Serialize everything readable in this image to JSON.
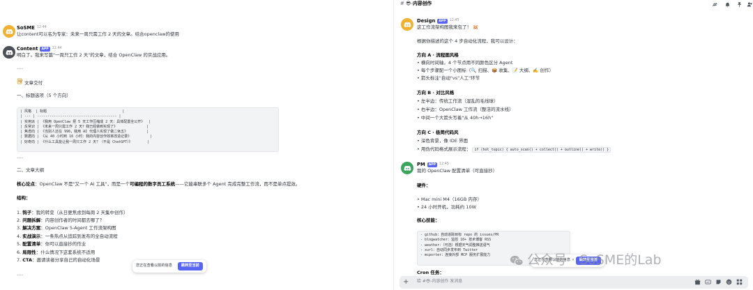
{
  "left": {
    "msg1": {
      "name": "SoSME",
      "time": "12:44",
      "text": "让content可以名为专家：未来一周只需工作 2 天的文章。结合openclaw的使用"
    },
    "msg2": {
      "name": "Content",
      "badge": "APP",
      "time": "12:44",
      "intro": "明白了。我来写篇\"一周只工作 2 天\"的文章，结合 OpenClaw 的实战应用。",
      "hr1": "----",
      "deliver": "文章交付",
      "sec1": "一、标题选项（5 个方向）",
      "table": "| 风格  | 标题                                    |\n| --- | -------------------------------------- |\n| 实用派 | 《我用 OpenClaw 把 5 天工作压缩成 2 天：具体配置全公开》  |\n| 反常识 | 《未来一周只需工作 2 天？我已经做到实现了》              |\n| 焦虑向 | 《当别人还在 996，我用 AI 代理人实现了做二休五》         |\n| 数据向 | 《从 40 小时到 16 小时：我的内容创作效率改造记录》         |\n| 好奇向 | 《什么工具能让我一周只工作 2 天？（不是 ChatGPT）》       |",
      "hr2": "----",
      "sec2": "二、文章大纲",
      "core_label": "核心论点",
      "core_text": "：OpenClaw 不是\"又一个 AI 工具\"，而是一个",
      "core_bold": "可编程的数字员工系统",
      "core_tail": "——它能串联多个 Agent 完成完整工作流，而不是单点提效。",
      "struct": "结构：",
      "items": [
        {
          "n": "1.",
          "b": "钩子",
          "t": "：我的转变（从日更焦虑到每周 2 天集中创作）"
        },
        {
          "n": "2.",
          "b": "问题拆解",
          "t": "：内容创作者的时间都去哪了？"
        },
        {
          "n": "3.",
          "b": "解决方案",
          "t": "：OpenClaw 5-Agent 工作流架构图"
        },
        {
          "n": "4.",
          "b": "实战演示",
          "t": "：一条热点从追踪到发布的全自动流程"
        },
        {
          "n": "5.",
          "b": "配置清单",
          "t": "：你可以直接抄的作业"
        },
        {
          "n": "6.",
          "b": "局限性",
          "t": "：什么情况下这套系统不适用"
        },
        {
          "n": "7.",
          "b": "CTA",
          "t": "：邀请读者分享自己的自动化场景"
        }
      ],
      "hr3": "----"
    },
    "pill": {
      "text": "您正在查看以前的信息",
      "button": "跳转至当前"
    }
  },
  "right": {
    "channel": "内容创作",
    "design": {
      "name": "Design",
      "badge": "APP",
      "time": "12:45",
      "l1": "这工作流架构图我来包了！",
      "l2": "根据你描述的这个 4 步自动化流程，我可以设计：",
      "a_title": "方向 A · 流程图风格",
      "a_items": [
        "横向时间轴，4 个节点用不同颜色区分 Agent",
        "每个步骤配一个小图标（🔍 扫描、📦 收集、📝 大纲、✍️ 创作）",
        "箭头标注\"自动\"vs\"人工\"环节"
      ],
      "b_title": "方向 B · 对比风格",
      "b_items": [
        "左半边：传统工作流（混乱的毛线球）",
        "右半边：OpenClaw 工作流（整洁的流水线）",
        "中间一个大箭头写着\"从 40h→16h\""
      ],
      "c_title": "方向 C · 极简代码风",
      "c_items": [
        "深色背景，像 IDE 界面",
        "用伪代码格式展示流程："
      ],
      "c_code": "if (hot_topic) { auto_scan() + collect() + outline() + write() }"
    },
    "pm": {
      "name": "PM",
      "badge": "APP",
      "time": "12:45",
      "intro": "我的 OpenClaw 配置清单（可直接抄）",
      "hw_title": "硬件：",
      "hw_items": [
        "Mac mini M4（16GB 内存）",
        "24 小时开机，功耗约 10W"
      ],
      "skills_title": "核心技能：",
      "skills_code": "- github：自动追踪目标 repo 的 issues/PR\n- blogwatcher：监控 10+ 技术博客 RSS\n- weather：（可选）根据天气调整推送语气\n- xurl：自动同步发布到 Twitter\n- mcporter：连接外部 MCP 服务扩展能力",
      "cron_title": "Cron 任务："
    },
    "pill": {
      "text": "您正在查看以前的信息",
      "button": "跳转至当前"
    },
    "composer_placeholder": "给 #😎-内容创作 发消息"
  },
  "watermark": "公众号 · SoSME的Lab",
  "colors": {
    "accent": "#5865f2",
    "discord_gray": "#8e9297",
    "avatar_green": "#3ba55d"
  }
}
